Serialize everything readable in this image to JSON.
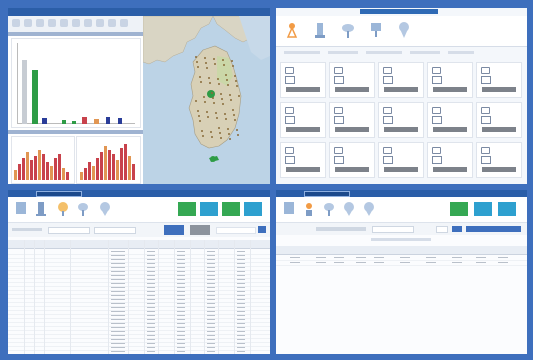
{
  "top_left": {
    "window_title": "",
    "toolbar_icons": [
      "home-icon",
      "folder-icon",
      "chart-icon",
      "map-icon",
      "list-icon",
      "settings-icon",
      "print-icon",
      "help-icon",
      "refresh-icon",
      "user-icon"
    ],
    "colors": {
      "bar_green": "#2e9c46",
      "bar_gray": "#c7ccd3",
      "bar_blue": "#2a3d99",
      "bar_red": "#c8424c",
      "bar_orange": "#e19653",
      "map_sea": "#bcd3e6",
      "map_land": "#d9d5c4"
    }
  },
  "top_right": {
    "title_button": "",
    "nav_icons": [
      "tower-icon",
      "station-icon",
      "cloud-sensor-icon",
      "network-icon",
      "location-pin-icon"
    ],
    "filters": [
      "",
      "",
      "",
      "",
      ""
    ],
    "cards": [
      {
        "id": "c1"
      },
      {
        "id": "c2"
      },
      {
        "id": "c3"
      },
      {
        "id": "c4"
      },
      {
        "id": "c5"
      },
      {
        "id": "c6"
      },
      {
        "id": "c7"
      },
      {
        "id": "c8"
      },
      {
        "id": "c9"
      },
      {
        "id": "c10"
      },
      {
        "id": "c11"
      },
      {
        "id": "c12"
      },
      {
        "id": "c13"
      },
      {
        "id": "c14"
      },
      {
        "id": "c15"
      }
    ]
  },
  "bottom_left": {
    "title": "",
    "search_label": "",
    "tiles": [
      {
        "color": "#35a853"
      },
      {
        "color": "#2ea0cf"
      },
      {
        "color": "#35a853"
      },
      {
        "color": "#2ea0cf"
      }
    ],
    "buttons": [
      "",
      ""
    ]
  },
  "bottom_right": {
    "title": "",
    "tiles": [
      {
        "color": "#35a853"
      },
      {
        "color": "#2ea0cf"
      },
      {
        "color": "#2ea0cf"
      }
    ],
    "nav_icons": [
      "device-icon",
      "monitor-icon",
      "cloud-sensor-icon",
      "location-pin-icon",
      "location-pin-icon"
    ]
  }
}
